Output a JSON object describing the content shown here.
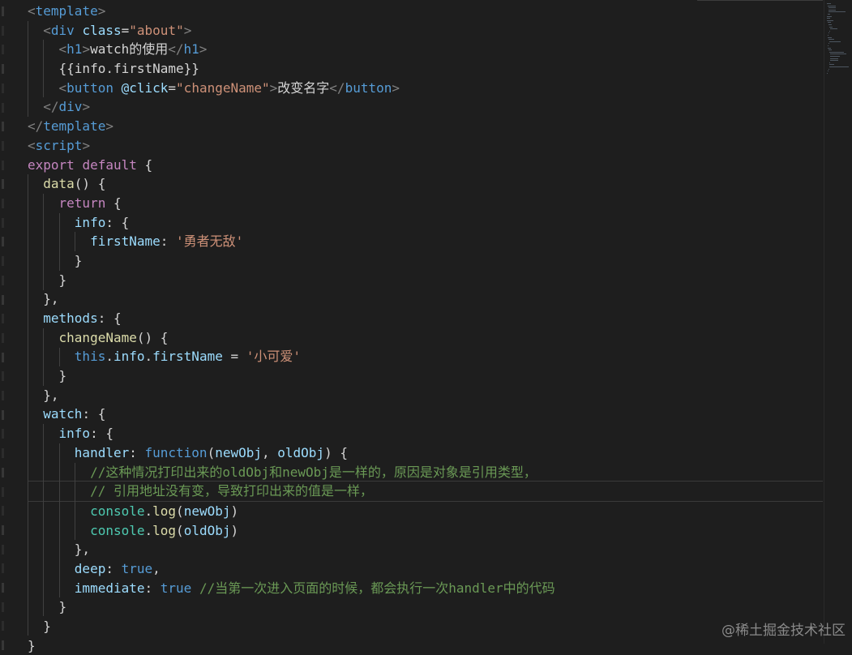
{
  "editor": {
    "lines": [
      [
        {
          "t": "<",
          "c": "punc"
        },
        {
          "t": "template",
          "c": "tag"
        },
        {
          "t": ">",
          "c": "punc"
        }
      ],
      [
        {
          "t": "  "
        },
        {
          "t": "<",
          "c": "punc"
        },
        {
          "t": "div",
          "c": "tag"
        },
        {
          "t": " "
        },
        {
          "t": "class",
          "c": "attr"
        },
        {
          "t": "=",
          "c": "plain"
        },
        {
          "t": "\"about\"",
          "c": "str"
        },
        {
          "t": ">",
          "c": "punc"
        }
      ],
      [
        {
          "t": "    "
        },
        {
          "t": "<",
          "c": "punc"
        },
        {
          "t": "h1",
          "c": "tag"
        },
        {
          "t": ">",
          "c": "punc"
        },
        {
          "t": "watch的使用",
          "c": "text"
        },
        {
          "t": "</",
          "c": "punc"
        },
        {
          "t": "h1",
          "c": "tag"
        },
        {
          "t": ">",
          "c": "punc"
        }
      ],
      [
        {
          "t": "    "
        },
        {
          "t": "{{info.firstName}}",
          "c": "text"
        }
      ],
      [
        {
          "t": "    "
        },
        {
          "t": "<",
          "c": "punc"
        },
        {
          "t": "button",
          "c": "tag"
        },
        {
          "t": " "
        },
        {
          "t": "@click",
          "c": "attr"
        },
        {
          "t": "=",
          "c": "plain"
        },
        {
          "t": "\"changeName\"",
          "c": "str"
        },
        {
          "t": ">",
          "c": "punc"
        },
        {
          "t": "改变名字",
          "c": "text"
        },
        {
          "t": "</",
          "c": "punc"
        },
        {
          "t": "button",
          "c": "tag"
        },
        {
          "t": ">",
          "c": "punc"
        }
      ],
      [
        {
          "t": "  "
        },
        {
          "t": "</",
          "c": "punc"
        },
        {
          "t": "div",
          "c": "tag"
        },
        {
          "t": ">",
          "c": "punc"
        }
      ],
      [
        {
          "t": "</",
          "c": "punc"
        },
        {
          "t": "template",
          "c": "tag"
        },
        {
          "t": ">",
          "c": "punc"
        }
      ],
      [
        {
          "t": "<",
          "c": "punc"
        },
        {
          "t": "script",
          "c": "tag"
        },
        {
          "t": ">",
          "c": "punc"
        }
      ],
      [
        {
          "t": "export",
          "c": "key"
        },
        {
          "t": " "
        },
        {
          "t": "default",
          "c": "key"
        },
        {
          "t": " {",
          "c": "plain"
        }
      ],
      [
        {
          "t": "  "
        },
        {
          "t": "data",
          "c": "fn"
        },
        {
          "t": "() {",
          "c": "plain"
        }
      ],
      [
        {
          "t": "    "
        },
        {
          "t": "return",
          "c": "key"
        },
        {
          "t": " {",
          "c": "plain"
        }
      ],
      [
        {
          "t": "      "
        },
        {
          "t": "info",
          "c": "prop"
        },
        {
          "t": ": {",
          "c": "plain"
        }
      ],
      [
        {
          "t": "        "
        },
        {
          "t": "firstName",
          "c": "prop"
        },
        {
          "t": ": ",
          "c": "plain"
        },
        {
          "t": "'勇者无敌'",
          "c": "str"
        }
      ],
      [
        {
          "t": "      "
        },
        {
          "t": "}",
          "c": "plain"
        }
      ],
      [
        {
          "t": "    "
        },
        {
          "t": "}",
          "c": "plain"
        }
      ],
      [
        {
          "t": "  "
        },
        {
          "t": "},",
          "c": "plain"
        }
      ],
      [
        {
          "t": "  "
        },
        {
          "t": "methods",
          "c": "prop"
        },
        {
          "t": ": {",
          "c": "plain"
        }
      ],
      [
        {
          "t": "    "
        },
        {
          "t": "changeName",
          "c": "fn"
        },
        {
          "t": "() {",
          "c": "plain"
        }
      ],
      [
        {
          "t": "      "
        },
        {
          "t": "this",
          "c": "kw"
        },
        {
          "t": ".",
          "c": "plain"
        },
        {
          "t": "info",
          "c": "prop"
        },
        {
          "t": ".",
          "c": "plain"
        },
        {
          "t": "firstName",
          "c": "prop"
        },
        {
          "t": " = ",
          "c": "plain"
        },
        {
          "t": "'小可爱'",
          "c": "str"
        }
      ],
      [
        {
          "t": "    "
        },
        {
          "t": "}",
          "c": "plain"
        }
      ],
      [
        {
          "t": "  "
        },
        {
          "t": "},",
          "c": "plain"
        }
      ],
      [
        {
          "t": "  "
        },
        {
          "t": "watch",
          "c": "prop"
        },
        {
          "t": ": {",
          "c": "plain"
        }
      ],
      [
        {
          "t": "    "
        },
        {
          "t": "info",
          "c": "prop"
        },
        {
          "t": ": {",
          "c": "plain"
        }
      ],
      [
        {
          "t": "      "
        },
        {
          "t": "handler",
          "c": "prop"
        },
        {
          "t": ": ",
          "c": "plain"
        },
        {
          "t": "function",
          "c": "kw"
        },
        {
          "t": "(",
          "c": "plain"
        },
        {
          "t": "newObj",
          "c": "prop"
        },
        {
          "t": ", ",
          "c": "plain"
        },
        {
          "t": "oldObj",
          "c": "prop"
        },
        {
          "t": ") {",
          "c": "plain"
        }
      ],
      [
        {
          "t": "        "
        },
        {
          "t": "//这种情况打印出来的oldObj和newObj是一样的，原因是对象是引用类型，",
          "c": "com"
        }
      ],
      [
        {
          "t": "        "
        },
        {
          "t": "// 引用地址没有变，导致打印出来的值是一样，",
          "c": "com"
        }
      ],
      [
        {
          "t": "        "
        },
        {
          "t": "console",
          "c": "var"
        },
        {
          "t": ".",
          "c": "plain"
        },
        {
          "t": "log",
          "c": "fn"
        },
        {
          "t": "(",
          "c": "plain"
        },
        {
          "t": "newObj",
          "c": "prop"
        },
        {
          "t": ")",
          "c": "plain"
        }
      ],
      [
        {
          "t": "        "
        },
        {
          "t": "console",
          "c": "var"
        },
        {
          "t": ".",
          "c": "plain"
        },
        {
          "t": "log",
          "c": "fn"
        },
        {
          "t": "(",
          "c": "plain"
        },
        {
          "t": "oldObj",
          "c": "prop"
        },
        {
          "t": ")",
          "c": "plain"
        }
      ],
      [
        {
          "t": "      "
        },
        {
          "t": "},",
          "c": "plain"
        }
      ],
      [
        {
          "t": "      "
        },
        {
          "t": "deep",
          "c": "prop"
        },
        {
          "t": ": ",
          "c": "plain"
        },
        {
          "t": "true",
          "c": "kw"
        },
        {
          "t": ",",
          "c": "plain"
        }
      ],
      [
        {
          "t": "      "
        },
        {
          "t": "immediate",
          "c": "prop"
        },
        {
          "t": ": ",
          "c": "plain"
        },
        {
          "t": "true",
          "c": "kw"
        },
        {
          "t": " "
        },
        {
          "t": "//当第一次进入页面的时候，都会执行一次handler中的代码",
          "c": "com"
        }
      ],
      [
        {
          "t": "    "
        },
        {
          "t": "}",
          "c": "plain"
        }
      ],
      [
        {
          "t": "  "
        },
        {
          "t": "}",
          "c": "plain"
        }
      ],
      [
        {
          "t": "}",
          "c": "plain"
        }
      ]
    ],
    "current_line": 25
  },
  "watermark": "@稀土掘金技术社区",
  "colors": {
    "background": "#1e1e1e",
    "tag": "#569cd6",
    "attribute": "#9cdcfe",
    "string": "#ce9178",
    "keyword": "#c586c0",
    "function": "#dcdcaa",
    "comment": "#6a9955"
  }
}
